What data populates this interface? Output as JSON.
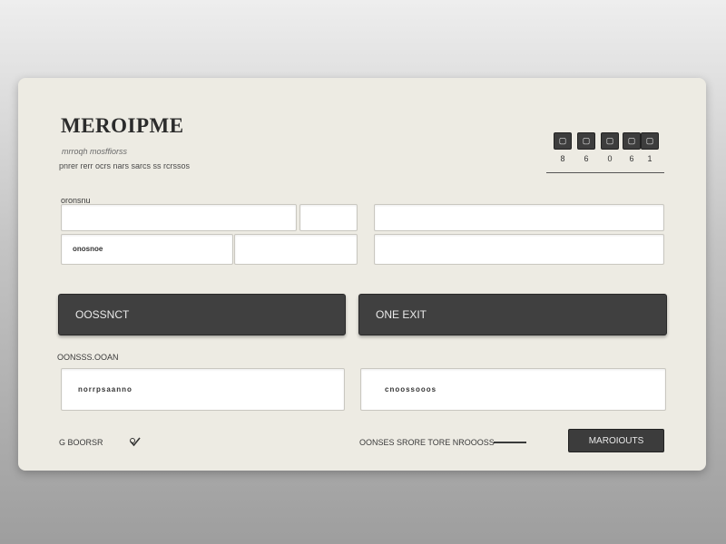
{
  "header": {
    "title": "MEROIPME",
    "subtitle": "mrroqh mosffiorss",
    "description": "pnrer rerr ocrs nars sarcs ss rcrssos"
  },
  "steps": {
    "items": [
      {
        "icon": "step-1-icon",
        "number": "8"
      },
      {
        "icon": "step-2-icon",
        "number": "6"
      },
      {
        "icon": "step-3-icon",
        "number": "0"
      },
      {
        "icon": "step-4-icon",
        "number": "6"
      },
      {
        "icon": "step-5-icon",
        "number": "1"
      }
    ]
  },
  "form": {
    "section_label": "oronsnu",
    "row2_field_label": "onosnoe",
    "primary_button_label": "OOSSNCT",
    "secondary_button_label": "ONE EXIT",
    "lower_section_label": "OONSSS.OOAN",
    "lower_left_value": "norrpsaanno",
    "lower_right_value": "cnoossooos"
  },
  "footer": {
    "left_text": "G BOORSR",
    "check_icon": "check-icon",
    "middle_text": "OONSES SRORE TORE NROOOSS",
    "submit_label": "MAROIOUTS"
  }
}
